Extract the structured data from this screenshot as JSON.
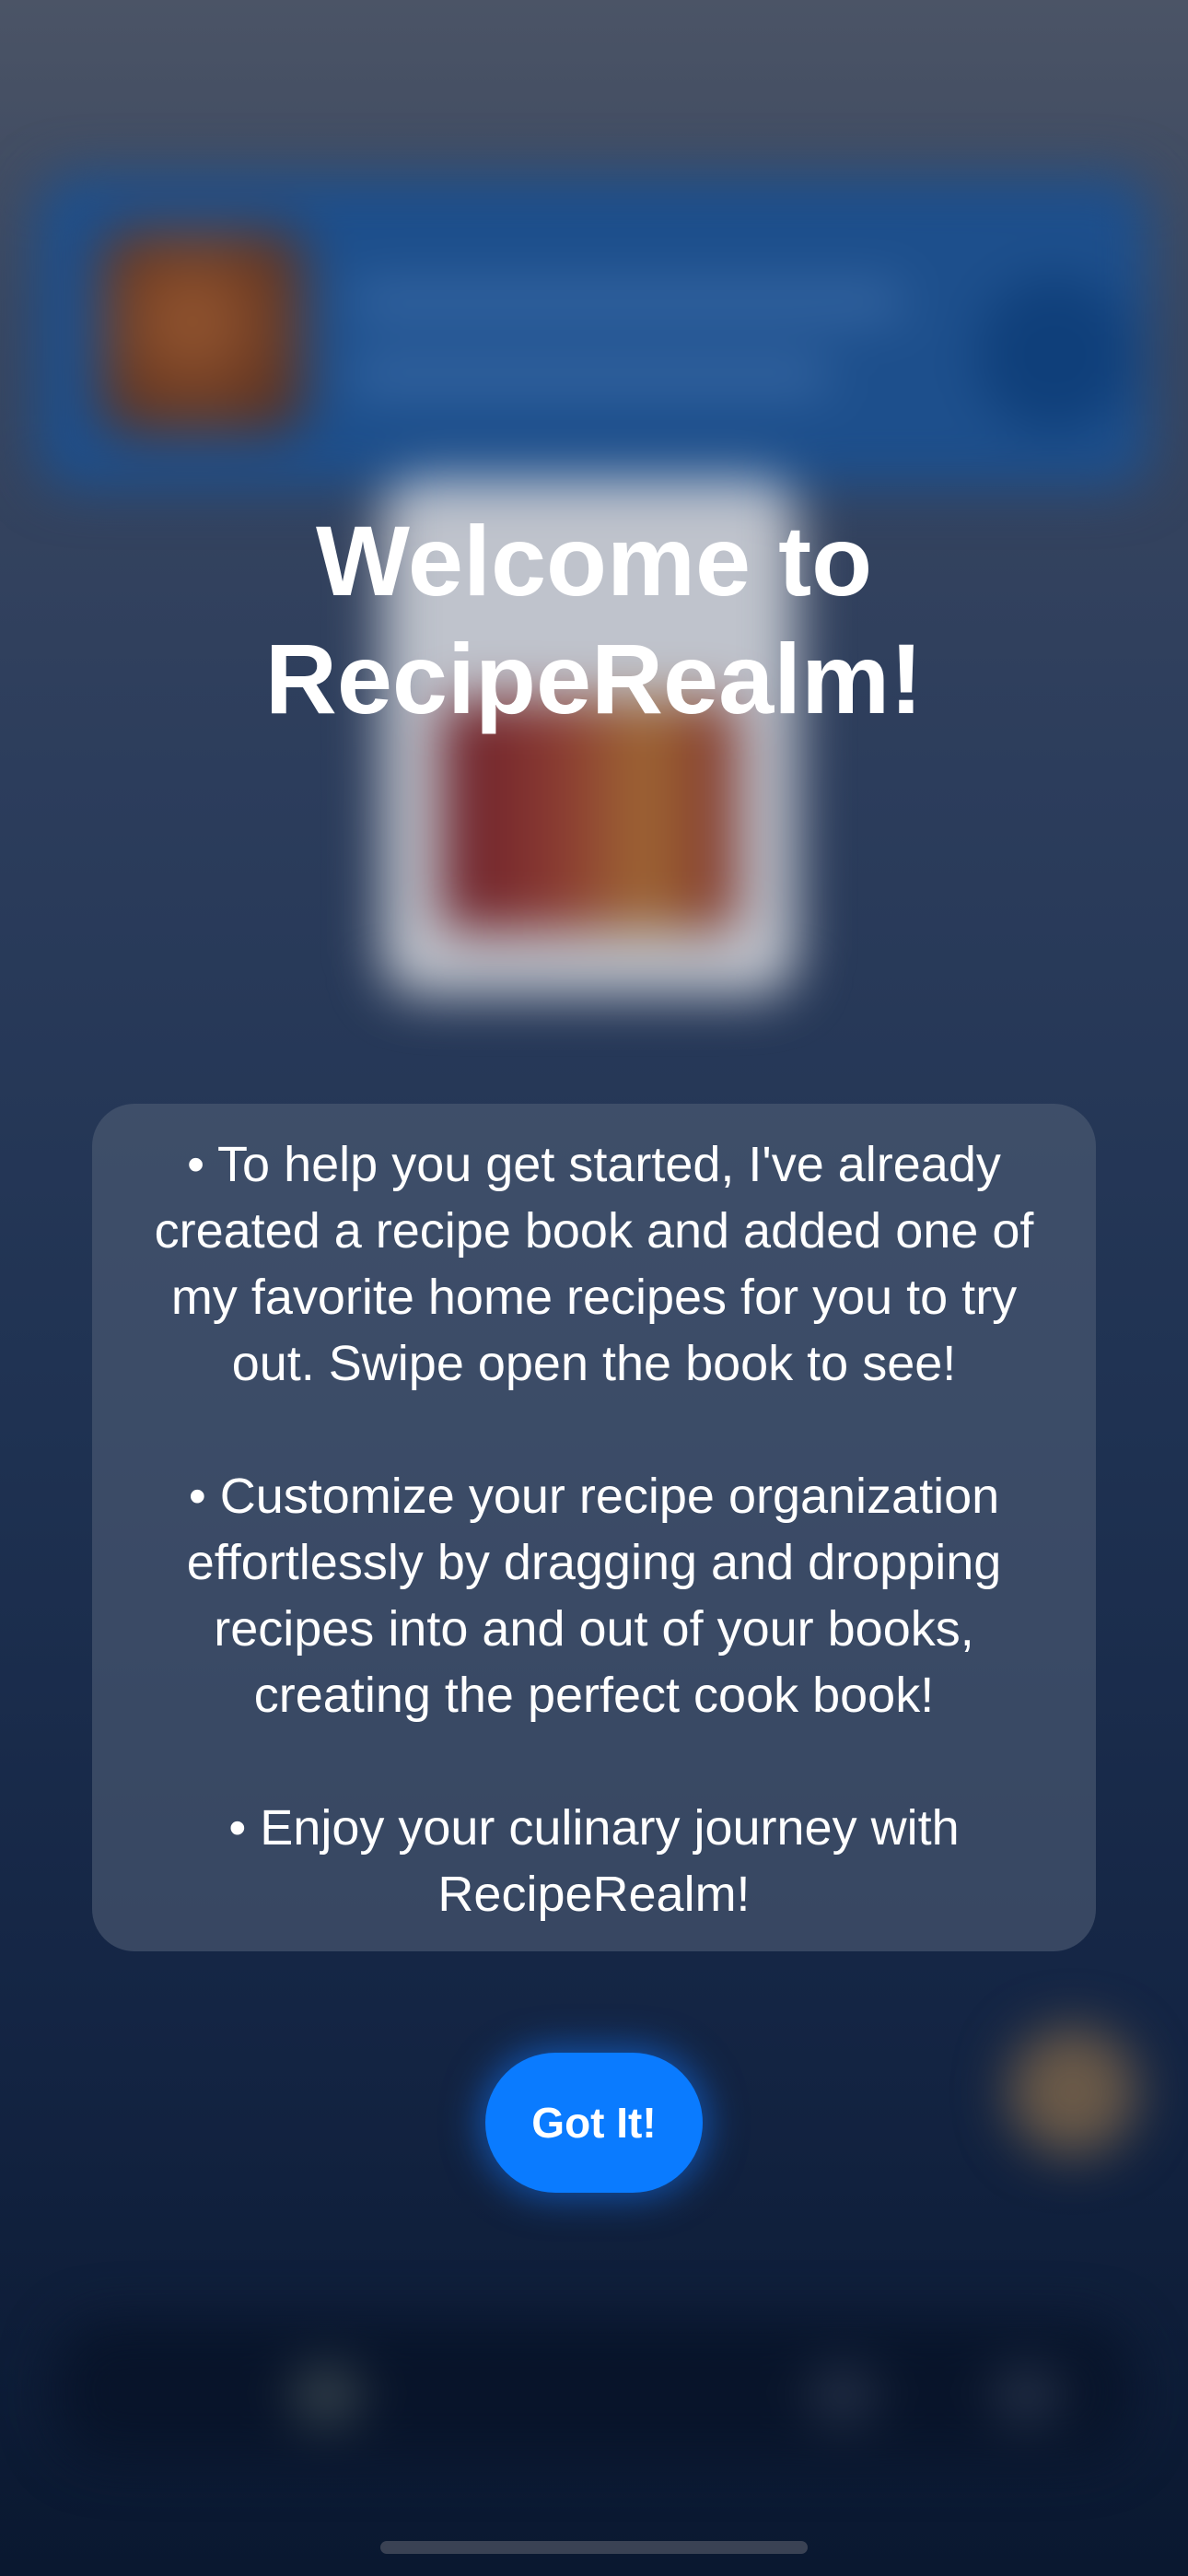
{
  "modal": {
    "title": "Welcome to\nRecipeRealm!",
    "paragraphs": [
      "• To help you get started, I've already created a recipe book and added one of my favorite home recipes for you to try out. Swipe open the book to see!",
      "• Customize your recipe organization effortlessly by dragging and dropping recipes into and out of your books, creating the perfect cook book!",
      "• Enjoy your culinary journey with RecipeRealm!"
    ],
    "button_label": "Got It!"
  },
  "colors": {
    "accent": "#0a7bff",
    "card_background": "#4e5c74",
    "text": "#ffffff"
  }
}
